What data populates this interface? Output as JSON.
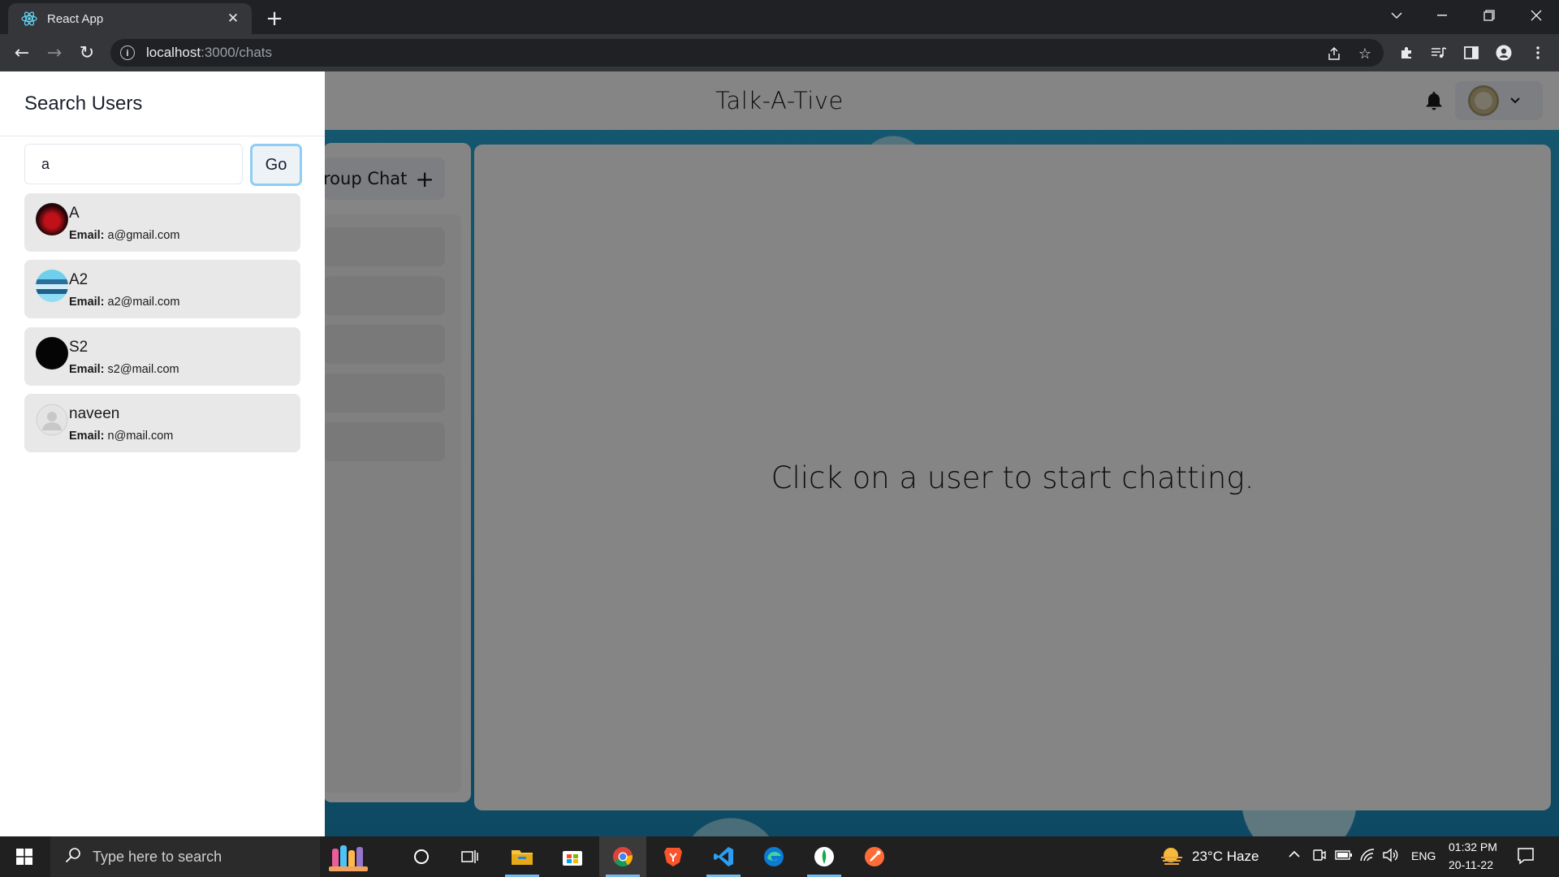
{
  "browser": {
    "tab_title": "React App",
    "tab_close": "✕",
    "new_tab": "+",
    "url_host": "localhost",
    "url_path": ":3000/chats",
    "back": "←",
    "forward": "→",
    "reload": "↻"
  },
  "app": {
    "title": "Talk-A-Tive",
    "chatbox_message": "Click on a user to start chatting.",
    "group_chat_label": "roup Chat",
    "group_chat_plus": "+"
  },
  "drawer": {
    "title": "Search Users",
    "search_value": "a",
    "go_label": "Go",
    "email_label": "Email:",
    "results": [
      {
        "name": "A",
        "email": "a@gmail.com"
      },
      {
        "name": "A2",
        "email": "a2@mail.com"
      },
      {
        "name": "S2",
        "email": "s2@mail.com"
      },
      {
        "name": "naveen",
        "email": "n@mail.com"
      }
    ]
  },
  "taskbar": {
    "search_placeholder": "Type here to search",
    "weather": "23°C  Haze",
    "language": "ENG",
    "time": "01:32 PM",
    "date": "20-11-22"
  }
}
